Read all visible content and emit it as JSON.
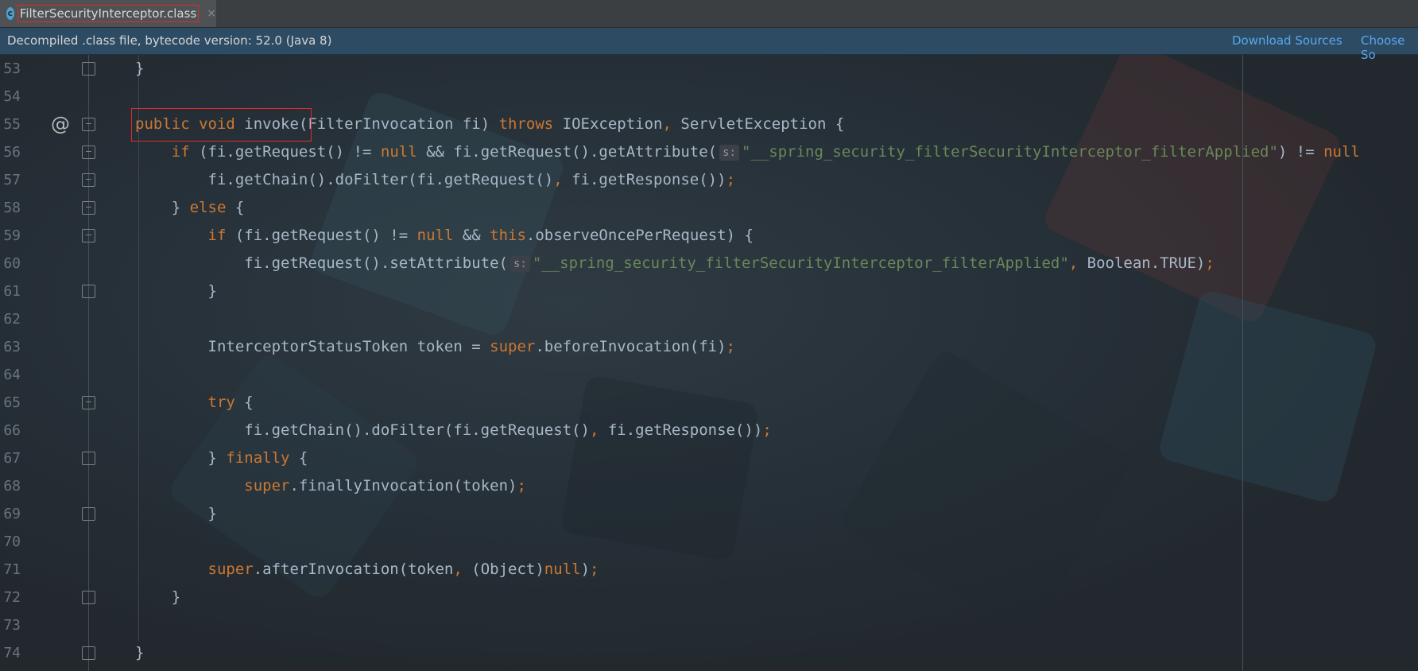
{
  "tab": {
    "icon": "class-file-icon",
    "name": "FilterSecurityInterceptor.class",
    "close": "×"
  },
  "infobar": {
    "message": "Decompiled .class file, bytecode version: 52.0 (Java 8)",
    "download_sources": "Download Sources",
    "choose_sources": "Choose So"
  },
  "lines": [
    {
      "n": "53",
      "tokens": [
        [
          "p",
          "}"
        ]
      ]
    },
    {
      "n": "54",
      "tokens": []
    },
    {
      "n": "55",
      "tokens": [
        [
          "kw",
          "public "
        ],
        [
          "kw",
          "void "
        ],
        [
          "p",
          "invoke(FilterInvocation fi) "
        ],
        [
          "kw",
          "throws "
        ],
        [
          "p",
          "IOException"
        ],
        [
          "sem",
          ", "
        ],
        [
          "p",
          "ServletException {"
        ]
      ]
    },
    {
      "n": "56",
      "tokens": [
        [
          "p",
          "    "
        ],
        [
          "kw",
          "if "
        ],
        [
          "p",
          "(fi.getRequest() != "
        ],
        [
          "kw",
          "null "
        ],
        [
          "p",
          "&& fi.getRequest().getAttribute("
        ],
        [
          "hint",
          "s:"
        ],
        [
          "str",
          "\"__spring_security_filterSecurityInterceptor_filterApplied\""
        ],
        [
          "p",
          ") != "
        ],
        [
          "kw",
          "null"
        ]
      ]
    },
    {
      "n": "57",
      "tokens": [
        [
          "p",
          "        fi.getChain().doFilter(fi.getRequest()"
        ],
        [
          "sem",
          ", "
        ],
        [
          "p",
          "fi.getResponse())"
        ],
        [
          "sem",
          ";"
        ]
      ]
    },
    {
      "n": "58",
      "tokens": [
        [
          "p",
          "    } "
        ],
        [
          "kw",
          "else "
        ],
        [
          "p",
          "{"
        ]
      ]
    },
    {
      "n": "59",
      "tokens": [
        [
          "p",
          "        "
        ],
        [
          "kw",
          "if "
        ],
        [
          "p",
          "(fi.getRequest() != "
        ],
        [
          "kw",
          "null "
        ],
        [
          "p",
          "&& "
        ],
        [
          "kw",
          "this"
        ],
        [
          "p",
          ".observeOncePerRequest) {"
        ]
      ]
    },
    {
      "n": "60",
      "tokens": [
        [
          "p",
          "            fi.getRequest().setAttribute("
        ],
        [
          "hint",
          "s:"
        ],
        [
          "str",
          "\"__spring_security_filterSecurityInterceptor_filterApplied\""
        ],
        [
          "sem",
          ", "
        ],
        [
          "p",
          "Boolean.TRUE)"
        ],
        [
          "sem",
          ";"
        ]
      ]
    },
    {
      "n": "61",
      "tokens": [
        [
          "p",
          "        }"
        ]
      ]
    },
    {
      "n": "62",
      "tokens": []
    },
    {
      "n": "63",
      "tokens": [
        [
          "p",
          "        InterceptorStatusToken token = "
        ],
        [
          "kw",
          "super"
        ],
        [
          "p",
          ".beforeInvocation(fi)"
        ],
        [
          "sem",
          ";"
        ]
      ]
    },
    {
      "n": "64",
      "tokens": []
    },
    {
      "n": "65",
      "tokens": [
        [
          "p",
          "        "
        ],
        [
          "kw",
          "try "
        ],
        [
          "p",
          "{"
        ]
      ]
    },
    {
      "n": "66",
      "tokens": [
        [
          "p",
          "            fi.getChain().doFilter(fi.getRequest()"
        ],
        [
          "sem",
          ", "
        ],
        [
          "p",
          "fi.getResponse())"
        ],
        [
          "sem",
          ";"
        ]
      ]
    },
    {
      "n": "67",
      "tokens": [
        [
          "p",
          "        } "
        ],
        [
          "kw",
          "finally "
        ],
        [
          "p",
          "{"
        ]
      ]
    },
    {
      "n": "68",
      "tokens": [
        [
          "p",
          "            "
        ],
        [
          "kw",
          "super"
        ],
        [
          "p",
          ".finallyInvocation(token)"
        ],
        [
          "sem",
          ";"
        ]
      ]
    },
    {
      "n": "69",
      "tokens": [
        [
          "p",
          "        }"
        ]
      ]
    },
    {
      "n": "70",
      "tokens": []
    },
    {
      "n": "71",
      "tokens": [
        [
          "p",
          "        "
        ],
        [
          "kw",
          "super"
        ],
        [
          "p",
          ".afterInvocation(token"
        ],
        [
          "sem",
          ", "
        ],
        [
          "p",
          "(Object)"
        ],
        [
          "kw",
          "null"
        ],
        [
          "p",
          ")"
        ],
        [
          "sem",
          ";"
        ]
      ]
    },
    {
      "n": "72",
      "tokens": [
        [
          "p",
          "    }"
        ]
      ]
    },
    {
      "n": "73",
      "tokens": []
    },
    {
      "n": "74",
      "tokens": [
        [
          "p",
          "}"
        ]
      ]
    }
  ],
  "annotation_line": "55",
  "annotation_glyph": "@",
  "fold_markers": {
    "53": "close",
    "55": "open",
    "56": "open",
    "57": "open",
    "58": "open",
    "59": "open",
    "61": "close",
    "65": "open",
    "67": "close",
    "69": "close",
    "72": "close",
    "74": "close"
  }
}
